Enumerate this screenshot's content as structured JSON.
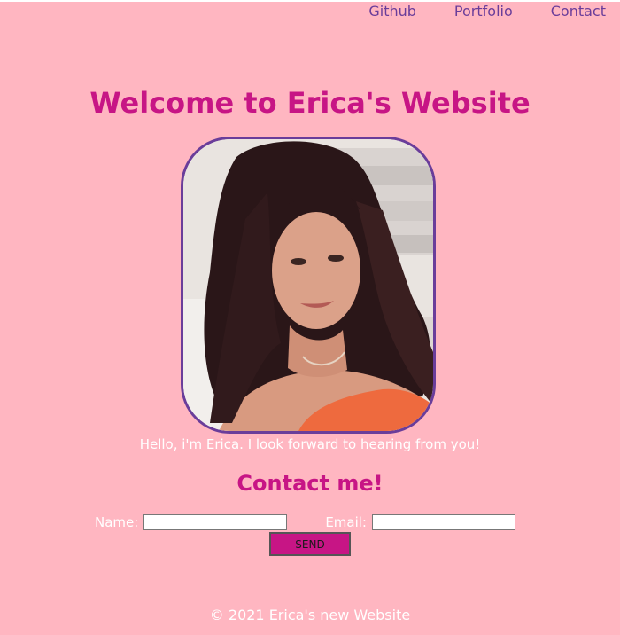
{
  "nav": {
    "links": [
      {
        "label": "Github"
      },
      {
        "label": "Portfolio"
      },
      {
        "label": "Contact"
      }
    ]
  },
  "header": {
    "title": "Welcome to Erica's Website"
  },
  "profile": {
    "intro": "Hello, i'm Erica. I look forward to hearing from you!"
  },
  "contact": {
    "heading": "Contact me!",
    "name_label": "Name:",
    "name_value": "",
    "email_label": "Email:",
    "email_value": "",
    "send_label": "SEND"
  },
  "footer": {
    "text": "© 2021 Erica's new Website"
  },
  "colors": {
    "background": "#ffb6c1",
    "heading": "#c71585",
    "nav_link": "#6a3d9a",
    "photo_border": "#6a3d9a",
    "button": "#c71585",
    "text_light": "#ffffff"
  }
}
